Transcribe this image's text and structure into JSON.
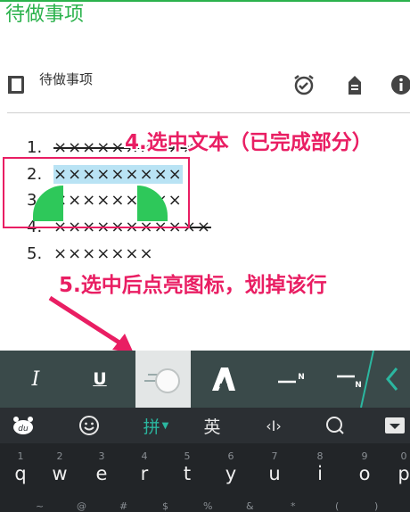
{
  "app": {
    "title": "待做事项"
  },
  "toolbar": {
    "note_label": "待做事项",
    "icons": [
      "notebook-icon",
      "alarm-check-icon",
      "label-icon",
      "info-icon"
    ]
  },
  "list": {
    "items": [
      {
        "num": "1.",
        "text": "××××××××××",
        "done": true
      },
      {
        "num": "2.",
        "text": "×××××××××",
        "done": false,
        "selected": true
      },
      {
        "num": "3.",
        "text": "×××××××××",
        "done": false
      },
      {
        "num": "4.",
        "text": "×××××××××××",
        "done": true
      },
      {
        "num": "5.",
        "text": "×××××××",
        "done": false
      }
    ]
  },
  "annotations": {
    "step4": "4.选中文本（已完成部分）",
    "step5": "5.选中后点亮图标，划掉该行"
  },
  "format_bar": {
    "italic": "I",
    "underline": "U",
    "superscript_label": "N",
    "subscript_label": "N"
  },
  "keyboard": {
    "top_row": {
      "pinyin": "拼",
      "english": "英",
      "cursor": "‹I›"
    },
    "letters": [
      "q",
      "w",
      "e",
      "r",
      "t",
      "y",
      "u",
      "i",
      "o",
      "p"
    ],
    "number_hints": [
      "1",
      "2",
      "3",
      "4",
      "5",
      "6",
      "7",
      "8",
      "9",
      "0"
    ],
    "symbol_hints": [
      "~",
      "@",
      "#",
      "$",
      "%",
      "&",
      "*",
      "(",
      ")"
    ]
  },
  "colors": {
    "accent_green": "#2bb24c",
    "annotation_pink": "#e91e63",
    "selection": "#b9e3f4"
  }
}
